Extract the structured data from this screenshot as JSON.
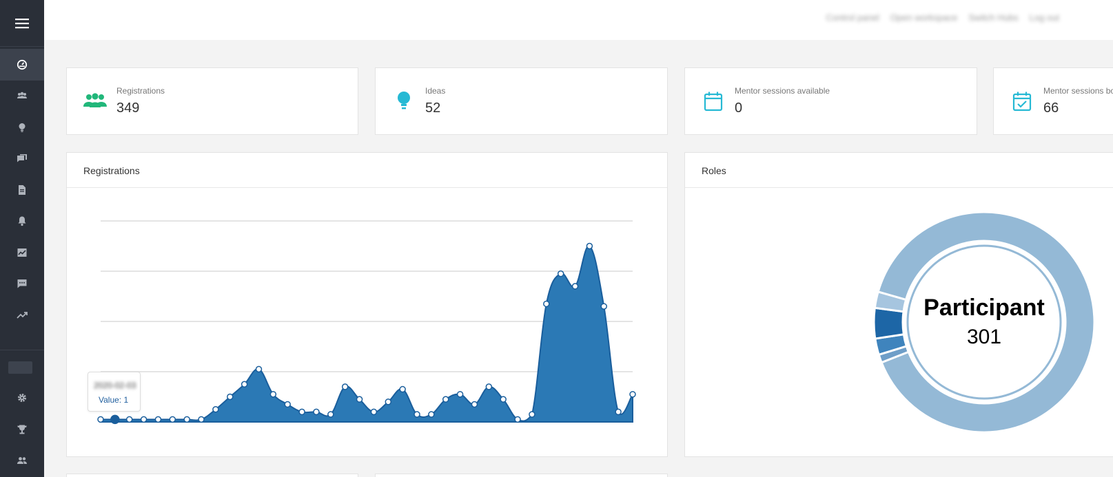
{
  "topnav": {
    "links": [
      "Control panel",
      "Open workspace",
      "Switch Hubs",
      "Log out"
    ]
  },
  "sidebar": {
    "items": [
      {
        "icon": "dashboard-icon",
        "active": true
      },
      {
        "icon": "users-icon"
      },
      {
        "icon": "lightbulb-icon"
      },
      {
        "icon": "chat-boxes-icon"
      },
      {
        "icon": "document-icon"
      },
      {
        "icon": "bell-icon"
      },
      {
        "icon": "chart-image-icon"
      },
      {
        "icon": "comment-icon"
      },
      {
        "icon": "trending-up-icon"
      },
      {
        "icon": "gear-icon"
      },
      {
        "icon": "trophy-icon"
      },
      {
        "icon": "group-icon"
      }
    ]
  },
  "stats": [
    {
      "label": "Registrations",
      "value": "349",
      "icon": "users-icon",
      "color": "#21b77a"
    },
    {
      "label": "Ideas",
      "value": "52",
      "icon": "lightbulb-icon",
      "color": "#26b9d4"
    },
    {
      "label": "Mentor sessions available",
      "value": "0",
      "icon": "calendar-icon",
      "color": "#26b9d4"
    },
    {
      "label": "Mentor sessions bo",
      "value": "66",
      "icon": "calendar-check-icon",
      "color": "#26b9d4"
    }
  ],
  "registrations_panel": {
    "title": "Registrations",
    "tooltip": {
      "date": "2020-02-03",
      "value_text": "Value: 1"
    }
  },
  "roles_panel": {
    "title": "Roles",
    "center_label": "Participant",
    "center_value": "301"
  },
  "colors": {
    "sidebar": "#2a2f38",
    "series": "#2b79b5",
    "series_stroke": "#1a5e9c",
    "donut_main": "#94b9d6"
  },
  "chart_data": [
    {
      "type": "area",
      "title": "Registrations",
      "ylim": [
        0,
        80
      ],
      "grid": true,
      "values": [
        1,
        1,
        1,
        1,
        1,
        1,
        1,
        1,
        5,
        10,
        15,
        21,
        11,
        7,
        4,
        4,
        3,
        14,
        9,
        4,
        8,
        13,
        3,
        3,
        9,
        11,
        7,
        14,
        9,
        1,
        3,
        47,
        59,
        54,
        70,
        46,
        4,
        11
      ]
    },
    {
      "type": "pie",
      "title": "Roles",
      "slices": [
        {
          "label": "Participant",
          "value": 301,
          "color": "#94b9d6"
        },
        {
          "label": "",
          "value": 4,
          "color": "#6e9ec8"
        },
        {
          "label": "",
          "value": 8,
          "color": "#3f84bd"
        },
        {
          "label": "",
          "value": 15,
          "color": "#1d66a6"
        },
        {
          "label": "",
          "value": 8,
          "color": "#a6c5df"
        }
      ]
    }
  ]
}
